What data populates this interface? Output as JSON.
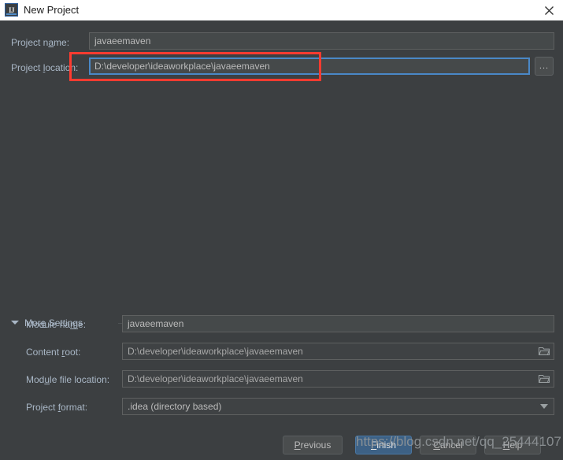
{
  "window": {
    "title": "New Project",
    "app_icon": "intellij-idea-icon",
    "close_icon": "close-icon"
  },
  "form": {
    "project_name": {
      "label": "Project name:",
      "label_pre": "Project n",
      "label_mnemonic": "a",
      "label_post": "me:",
      "value": "javaeemaven"
    },
    "project_location": {
      "label": "Project location:",
      "label_pre": "Project ",
      "label_mnemonic": "l",
      "label_post": "ocation:",
      "value": "D:\\developer\\ideaworkplace\\javaeemaven",
      "browse_label": "..."
    }
  },
  "more_settings": {
    "label": "More Settings",
    "label_pre": "Mor",
    "label_mnemonic": "e",
    "label_post": " Settings",
    "expanded": true,
    "toggle_icon": "chevron-down-icon",
    "fields": {
      "module_name": {
        "label": "Module name:",
        "label_pre": "Module na",
        "label_mnemonic": "m",
        "label_post": "e:",
        "value": "javaeemaven"
      },
      "content_root": {
        "label": "Content root:",
        "label_pre": "Content ",
        "label_mnemonic": "r",
        "label_post": "oot:",
        "value": "D:\\developer\\ideaworkplace\\javaeemaven",
        "folder_icon": "folder-icon"
      },
      "module_file_location": {
        "label": "Module file location:",
        "label_pre": "Mod",
        "label_mnemonic": "u",
        "label_post": "le file location:",
        "value": "D:\\developer\\ideaworkplace\\javaeemaven",
        "folder_icon": "folder-icon"
      },
      "project_format": {
        "label": "Project format:",
        "label_pre": "Project ",
        "label_mnemonic": "f",
        "label_post": "ormat:",
        "value": ".idea (directory based)",
        "dropdown_icon": "chevron-down-icon"
      }
    }
  },
  "footer": {
    "previous": {
      "label": "Previous",
      "label_pre": "",
      "label_mnemonic": "P",
      "label_post": "revious"
    },
    "finish": {
      "label": "Finish",
      "label_pre": "",
      "label_mnemonic": "F",
      "label_post": "inish"
    },
    "cancel": {
      "label": "Cancel",
      "label_pre": "",
      "label_mnemonic": "C",
      "label_post": "ancel"
    },
    "help": {
      "label": "Help",
      "label_pre": "",
      "label_mnemonic": "H",
      "label_post": "elp"
    }
  },
  "watermark": {
    "text": "https://blog.csdn.net/qq_25444107"
  },
  "colors": {
    "background": "#3c3f41",
    "field_background": "#45494a",
    "label_text": "#a9b7c6",
    "focus_border": "#4a88c7",
    "highlight_box": "#ff3b30",
    "primary_button": "#3d6185",
    "titlebar": "#ffffff"
  }
}
